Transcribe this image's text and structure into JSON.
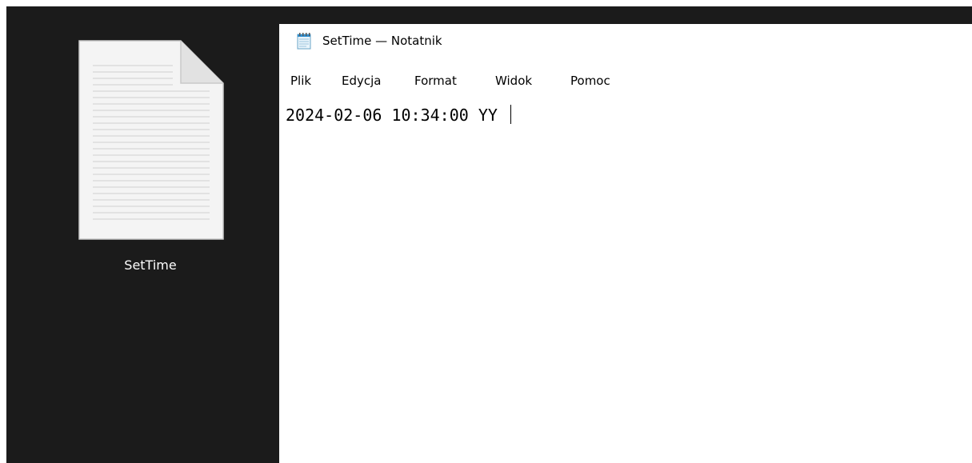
{
  "desktop": {
    "file_icon": "text-document-icon",
    "file_label": "SetTime"
  },
  "window": {
    "app_icon": "notepad-icon",
    "title": "SetTime — Notatnik",
    "menu": [
      "Plik",
      "Edycja",
      "Format",
      "Widok",
      "Pomoc"
    ]
  },
  "editor": {
    "content": "2024-02-06 10:34:00 YY "
  },
  "colors": {
    "desktop_background": "#1b1b1b",
    "window_background": "#ffffff",
    "text": "#000000"
  }
}
